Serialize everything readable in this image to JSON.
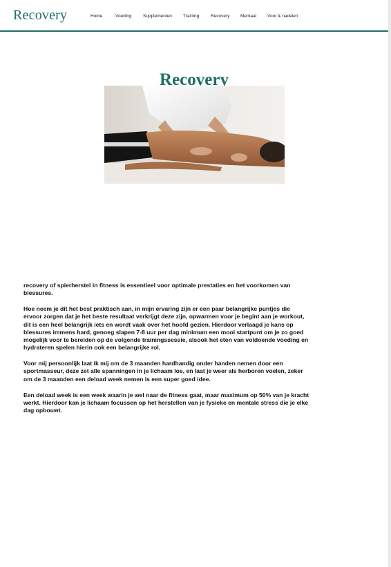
{
  "header": {
    "brand": "Recovery",
    "nav": [
      {
        "label": "Home"
      },
      {
        "label": "Voeding"
      },
      {
        "label": "Supplementen"
      },
      {
        "label": "Training"
      },
      {
        "label": "Recovery"
      },
      {
        "label": "Mentaal"
      },
      {
        "label": "Voor & nadelen"
      }
    ]
  },
  "main": {
    "title": "Recovery",
    "hero_image": {
      "icon": "massage-photo"
    },
    "paragraphs": [
      "recovery of spierherstel in fitness is essentieel voor optimale prestaties en het voorkomen van blessures.",
      "Hoe neem je dit het best praktisch aan, in mijn ervaring zijn er een paar belangrijke puntjes die ervoor zorgen dat je het beste resultaat verkrijgt deze zijn, opwarmen voor je begint aan je workout, dit is een heel belangrijk iets en wordt vaak over het hoofd gezien. Hierdoor verlaagd je kans op blessures immens hard, genoeg slapen 7-8 uur per dag minimum een mooi startpunt om je zo goed mogelijk voor te bereiden op de volgende trainingssessie, alsook het eten van voldoende voeding en hydrateren spelen hierin ook een belangrijke rol.",
      "Voor mij persoonlijk laat ik mij om de 3 maanden hardhandig onder handen nemen door een sportmasseur, deze zet alle spanningen in je lichaam los, en laat je weer als herboren voelen, zeker om de 3 maanden een deload week nemen is een super goed idee.",
      "Een deload week is een week waarin je wel naar de fitness gaat, maar maximum op 50% van je kracht werkt. Hierdoor kan je lichaam focussen op het herstellen van je fysieke en mentale stress die je elke dag opbouwt."
    ]
  },
  "colors": {
    "accent": "#1f6f64",
    "text": "#121212",
    "background": "#ffffff"
  }
}
